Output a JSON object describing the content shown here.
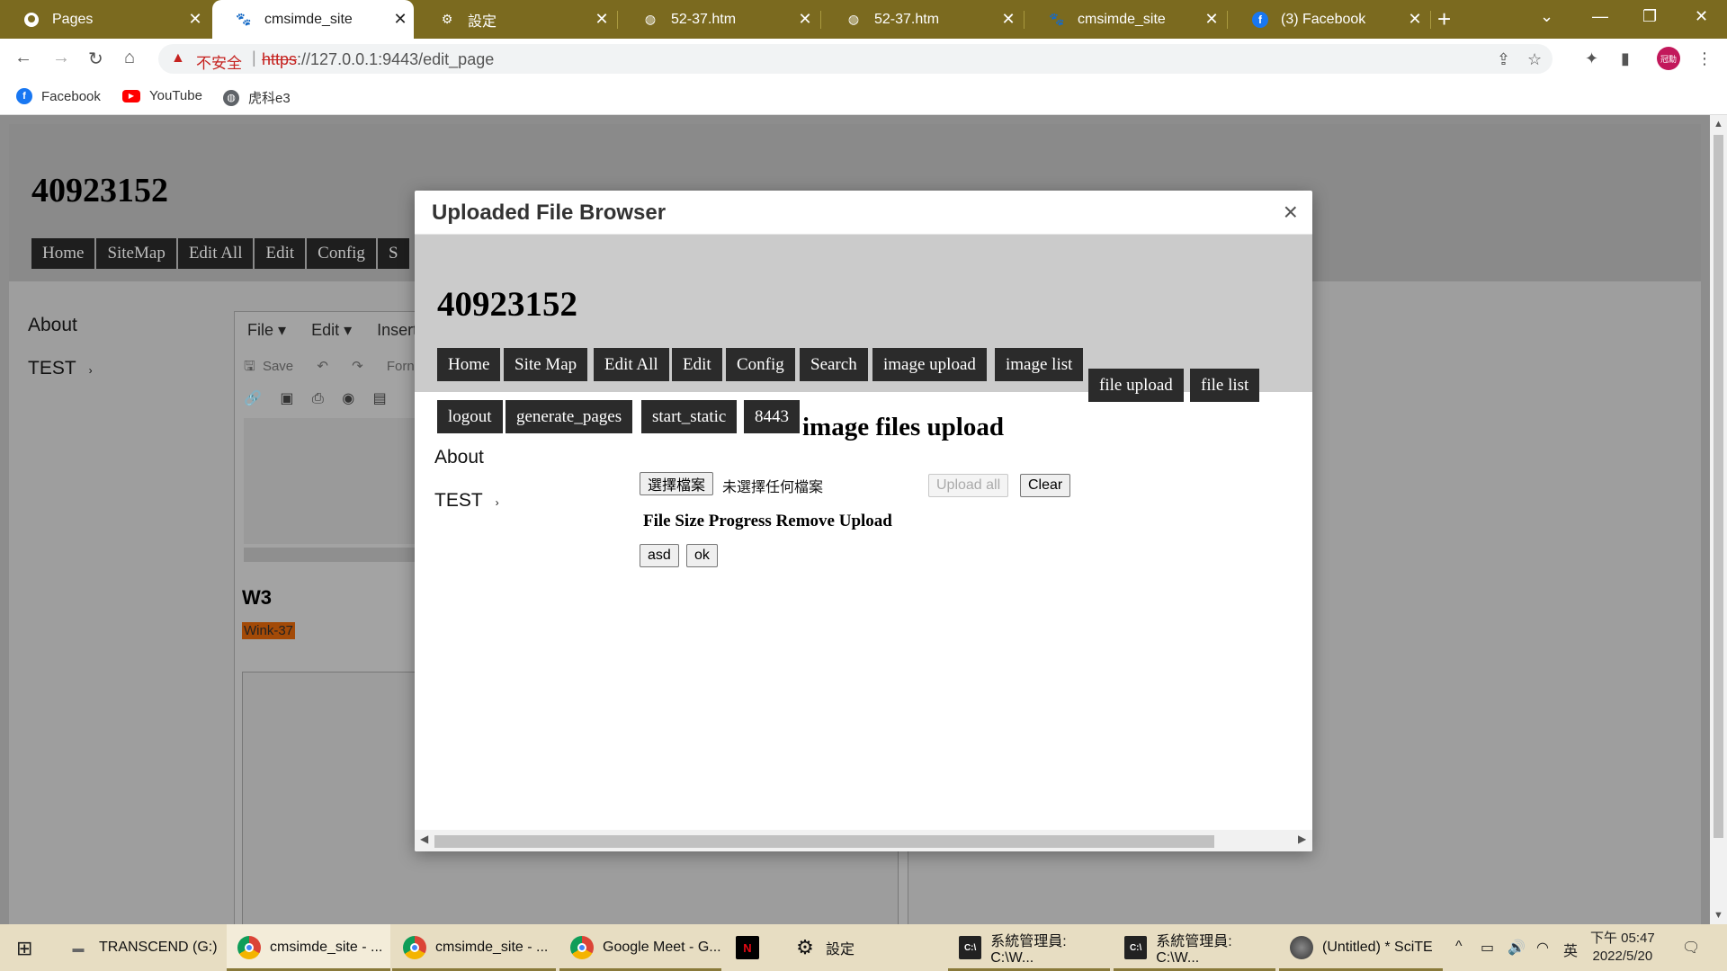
{
  "browser": {
    "tabs": [
      {
        "title": "Pages",
        "icon": "github-icon"
      },
      {
        "title": "cmsimde_site",
        "icon": "cmsimde-icon",
        "active": true
      },
      {
        "title": "設定",
        "icon": "gear-icon"
      },
      {
        "title": "52-37.htm",
        "icon": "globe-icon"
      },
      {
        "title": "52-37.htm",
        "icon": "globe-icon"
      },
      {
        "title": "cmsimde_site",
        "icon": "cmsimde-icon"
      },
      {
        "title": "(3) Facebook",
        "icon": "facebook-icon"
      }
    ],
    "security_label": "不安全",
    "url_protocol": "https",
    "url_rest": "://127.0.0.1:9443/edit_page",
    "profile_label": "冠勳",
    "bookmarks": [
      {
        "label": "Facebook",
        "icon": "facebook-icon",
        "color": "#1877f2"
      },
      {
        "label": "YouTube",
        "icon": "youtube-icon",
        "color": "#ff0000"
      },
      {
        "label": "虎科e3",
        "icon": "globe-icon",
        "color": "#5f6368"
      }
    ]
  },
  "background_page": {
    "site_title": "40923152",
    "menu": [
      "Home",
      "SiteMap",
      "Edit All",
      "Edit",
      "Config",
      "S"
    ],
    "side": [
      "About",
      "TEST"
    ],
    "editor_menu": [
      "File",
      "Edit",
      "Insert"
    ],
    "editor_save": "Save",
    "editor_format": "Forn",
    "heading": "W3",
    "highlight": "Wink-37"
  },
  "modal": {
    "title": "Uploaded File Browser",
    "site_title": "40923152",
    "nav_row1": [
      "Home",
      "Site Map",
      "Edit All",
      "Edit",
      "Config",
      "Search",
      "image upload",
      "image list"
    ],
    "nav_row1b": [
      "file upload",
      "file list"
    ],
    "nav_row2": [
      "logout",
      "generate_pages",
      "start_static",
      "8443"
    ],
    "section_heading": "image files upload",
    "side": [
      "About",
      "TEST"
    ],
    "choose_file": "選擇檔案",
    "no_file": "未選擇任何檔案",
    "upload_all": "Upload all",
    "clear": "Clear",
    "table_header": "File Size Progress Remove Upload",
    "btn_asd": "asd",
    "btn_ok": "ok"
  },
  "taskbar": {
    "items": [
      {
        "label": "TRANSCEND (G:)",
        "icon": "drive-icon"
      },
      {
        "label": "cmsimde_site - ...",
        "icon": "chrome-icon",
        "active": true
      },
      {
        "label": "cmsimde_site - ...",
        "icon": "chrome-icon"
      },
      {
        "label": "Google Meet - G...",
        "icon": "chrome-icon"
      },
      {
        "label": "",
        "icon": "netflix-icon"
      },
      {
        "label": "設定",
        "icon": "gear-icon"
      },
      {
        "label": "系統管理員: C:\\W...",
        "icon": "terminal-icon"
      },
      {
        "label": "系統管理員: C:\\W...",
        "icon": "terminal-icon"
      },
      {
        "label": "(Untitled) * SciTE",
        "icon": "scite-icon"
      }
    ],
    "ime": "英",
    "time": "下午 05:47",
    "date": "2022/5/20"
  }
}
